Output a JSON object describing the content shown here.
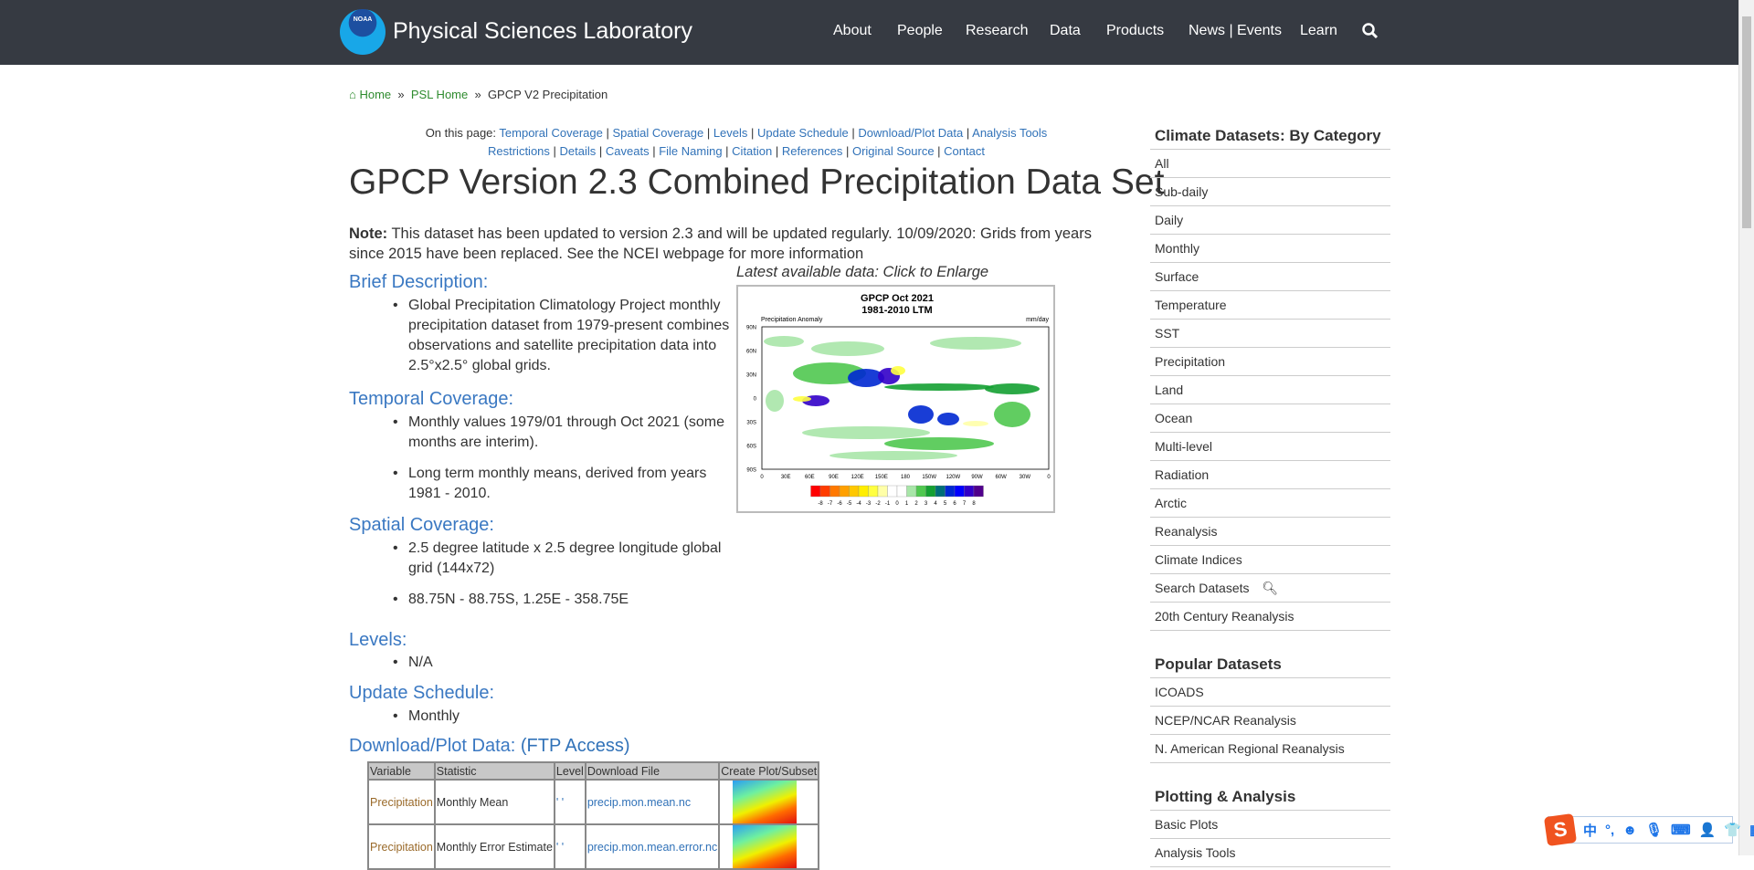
{
  "header": {
    "logo_text": "NOAA",
    "title": "Physical Sciences Laboratory",
    "nav": [
      "About",
      "People",
      "Research",
      "Data",
      "Products",
      "News | Events",
      "Learn"
    ]
  },
  "breadcrumb": [
    "Home",
    "PSL Home",
    "GPCP V2 Precipitation"
  ],
  "on_this_page": {
    "label": "On this page:",
    "links": [
      "Temporal Coverage",
      "Spatial Coverage",
      "Levels",
      "Update Schedule",
      "Download/Plot Data",
      "Analysis Tools",
      "Restrictions",
      "Details",
      "Caveats",
      "File Naming",
      "Citation",
      "References",
      "Original Source",
      "Contact"
    ]
  },
  "title": "GPCP Version 2.3 Combined Precipitation Data Set",
  "note": {
    "label": "Note:",
    "text": " This dataset has been updated to version 2.3 and will be updated regularly. 10/09/2020: Grids from years since 2015 have been replaced. See the NCEI webpage for more information"
  },
  "figure": {
    "caption": "Latest available data: Click to Enlarge",
    "title1": "GPCP Oct 2021",
    "title2": "1981-2010 LTM",
    "left_label": "Precipitation Anomaly",
    "right_label": "mm/day",
    "lat_ticks": [
      "90N",
      "60N",
      "30N",
      "0",
      "30S",
      "60S",
      "90S"
    ],
    "lon_ticks": [
      "0",
      "30E",
      "60E",
      "90E",
      "120E",
      "150E",
      "180",
      "150W",
      "120W",
      "90W",
      "60W",
      "30W",
      "0"
    ],
    "colorbar_colors": [
      "#ff0000",
      "#ff3c00",
      "#ff7800",
      "#ffa000",
      "#ffc800",
      "#ffee00",
      "#ffff40",
      "#ffffa8",
      "#ffffff",
      "#ffffff",
      "#a8e6a8",
      "#50c850",
      "#14a032",
      "#006e78",
      "#0028d2",
      "#0000ff",
      "#3200c8",
      "#50008c"
    ],
    "colorbar_labels": [
      "-8",
      "-7",
      "-6",
      "-5",
      "-4",
      "-3",
      "-2",
      "-1",
      "0",
      "1",
      "2",
      "3",
      "4",
      "5",
      "6",
      "7",
      "8"
    ]
  },
  "sections": {
    "brief": {
      "heading": "Brief Description:",
      "items": [
        "Global Precipitation Climatology Project monthly precipitation dataset from 1979-present combines observations and satellite precipitation data into 2.5°x2.5° global grids."
      ]
    },
    "temporal": {
      "heading": "Temporal Coverage:",
      "items": [
        "Monthly values 1979/01 through Oct 2021 (some months are interim).",
        "Long term monthly means, derived from years 1981 - 2010."
      ]
    },
    "spatial": {
      "heading": "Spatial Coverage:",
      "items": [
        "2.5 degree latitude x 2.5 degree longitude global grid (144x72)",
        "88.75N - 88.75S, 1.25E - 358.75E"
      ]
    },
    "levels": {
      "heading": "Levels:",
      "items": [
        "N/A"
      ]
    },
    "update": {
      "heading": "Update Schedule:",
      "items": [
        "Monthly"
      ]
    },
    "download": {
      "heading": "Download/Plot Data:",
      "link": "(FTP Access)"
    }
  },
  "table": {
    "headers": [
      "Variable",
      "Statistic",
      "Level",
      "Download File",
      "Create Plot/Subset"
    ],
    "rows": [
      [
        "Precipitation",
        "Monthly Mean",
        "' '",
        "precip.mon.mean.nc"
      ],
      [
        "Precipitation",
        "Monthly Error Estimate",
        "' '",
        "precip.mon.mean.error.nc"
      ]
    ]
  },
  "sidebar": {
    "cat_heading": "Climate Datasets: By Category",
    "categories": [
      "All",
      "Sub-daily",
      "Daily",
      "Monthly",
      "Surface",
      "Temperature",
      "SST",
      "Precipitation",
      "Land",
      "Ocean",
      "Multi-level",
      "Radiation",
      "Arctic",
      "Reanalysis",
      "Climate Indices",
      "Search Datasets",
      "20th Century Reanalysis"
    ],
    "pop_heading": "Popular Datasets",
    "popular": [
      "ICOADS",
      "NCEP/NCAR Reanalysis",
      "N. American Regional Reanalysis"
    ],
    "plot_heading": "Plotting & Analysis",
    "plotting": [
      "Basic Plots",
      "Analysis Tools"
    ]
  },
  "ime": {
    "logo": "S",
    "lang": "中",
    "punct": "°,"
  }
}
